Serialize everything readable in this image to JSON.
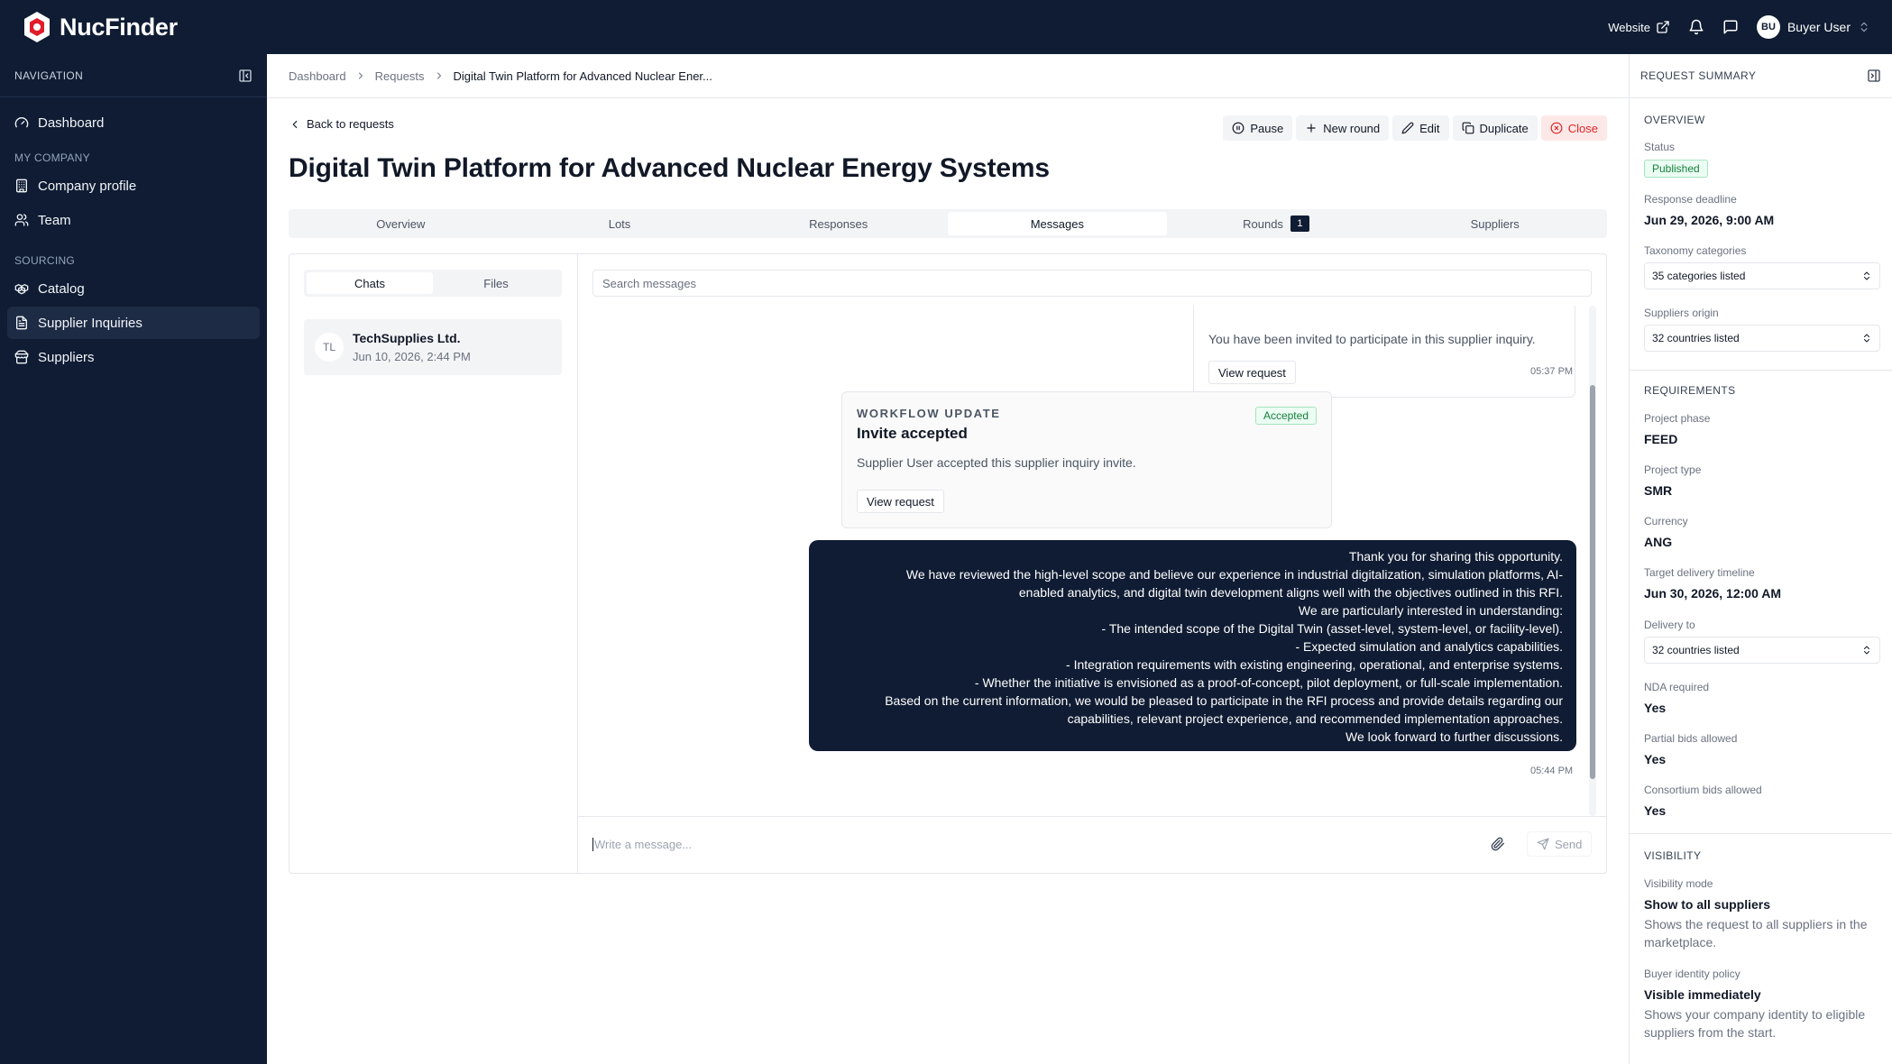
{
  "app": {
    "name": "NucFinder"
  },
  "topbar": {
    "website": "Website",
    "avatar_initials": "BU",
    "user_name": "Buyer User"
  },
  "sidebar": {
    "header": "NAVIGATION",
    "items": [
      {
        "label": "Dashboard"
      },
      {
        "section": "MY COMPANY"
      },
      {
        "label": "Company profile"
      },
      {
        "label": "Team"
      },
      {
        "section": "SOURCING"
      },
      {
        "label": "Catalog"
      },
      {
        "label": "Supplier Inquiries"
      },
      {
        "label": "Suppliers"
      }
    ]
  },
  "breadcrumb": [
    "Dashboard",
    "Requests",
    "Digital Twin Platform for Advanced Nuclear Ener..."
  ],
  "back": "Back to requests",
  "actions": {
    "pause": "Pause",
    "new_round": "New round",
    "edit": "Edit",
    "duplicate": "Duplicate",
    "close": "Close"
  },
  "page_title": "Digital Twin Platform for Advanced Nuclear Energy Systems",
  "tabs": [
    {
      "label": "Overview"
    },
    {
      "label": "Lots"
    },
    {
      "label": "Responses"
    },
    {
      "label": "Messages"
    },
    {
      "label": "Rounds",
      "badge": "1"
    },
    {
      "label": "Suppliers"
    }
  ],
  "chat_tabs": {
    "chats": "Chats",
    "files": "Files"
  },
  "chat_item": {
    "initials": "TL",
    "name": "TechSupplies Ltd.",
    "date": "Jun 10, 2026, 2:44 PM"
  },
  "messages": {
    "search_placeholder": "Search messages",
    "invite_text": "You have been invited to participate in this supplier inquiry.",
    "invite_button": "View request",
    "invite_time": "05:37 PM",
    "workflow_label": "WORKFLOW UPDATE",
    "workflow_title": "Invite accepted",
    "workflow_badge": "Accepted",
    "workflow_text": "Supplier User accepted this supplier inquiry invite.",
    "workflow_button": "View request",
    "reply_lines": [
      "Thank you for sharing this opportunity.",
      "We have reviewed the high-level scope and believe our experience in industrial digitalization, simulation platforms, AI-",
      "enabled analytics, and digital twin development aligns well with the objectives outlined in this RFI.",
      "We are particularly interested in understanding:",
      "- The intended scope of the Digital Twin (asset-level, system-level, or facility-level).",
      "- Expected simulation and analytics capabilities.",
      "- Integration requirements with existing engineering, operational, and enterprise systems.",
      "- Whether the initiative is envisioned as a proof-of-concept, pilot deployment, or full-scale implementation.",
      "Based on the current information, we would be pleased to participate in the RFI process and provide details regarding our",
      "capabilities, relevant project experience, and recommended implementation approaches.",
      "We look forward to further discussions."
    ],
    "reply_time": "05:44 PM",
    "composer_placeholder": "Write a message...",
    "send": "Send"
  },
  "summary": {
    "header": "REQUEST SUMMARY",
    "overview": "OVERVIEW",
    "status_label": "Status",
    "status": "Published",
    "deadline_label": "Response deadline",
    "deadline": "Jun 29, 2026, 9:00 AM",
    "taxonomy_label": "Taxonomy categories",
    "taxonomy": "35 categories listed",
    "origin_label": "Suppliers origin",
    "origin": "32 countries listed",
    "requirements": "REQUIREMENTS",
    "phase_label": "Project phase",
    "phase": "FEED",
    "type_label": "Project type",
    "type": "SMR",
    "currency_label": "Currency",
    "currency": "ANG",
    "delivery_timeline_label": "Target delivery timeline",
    "delivery_timeline": "Jun 30, 2026, 12:00 AM",
    "delivery_to_label": "Delivery to",
    "delivery_to": "32 countries listed",
    "nda_label": "NDA required",
    "nda": "Yes",
    "partial_label": "Partial bids allowed",
    "partial": "Yes",
    "consortium_label": "Consortium bids allowed",
    "consortium": "Yes",
    "visibility": "VISIBILITY",
    "vis_mode_label": "Visibility mode",
    "vis_mode": "Show to all suppliers",
    "vis_mode_desc": "Shows the request to all suppliers in the marketplace.",
    "identity_label": "Buyer identity policy",
    "identity": "Visible immediately",
    "identity_desc": "Shows your company identity to eligible suppliers from the start."
  },
  "colors": {
    "navy": "#0f1c33",
    "accent_green": "#15803d",
    "danger": "#dc2626"
  }
}
